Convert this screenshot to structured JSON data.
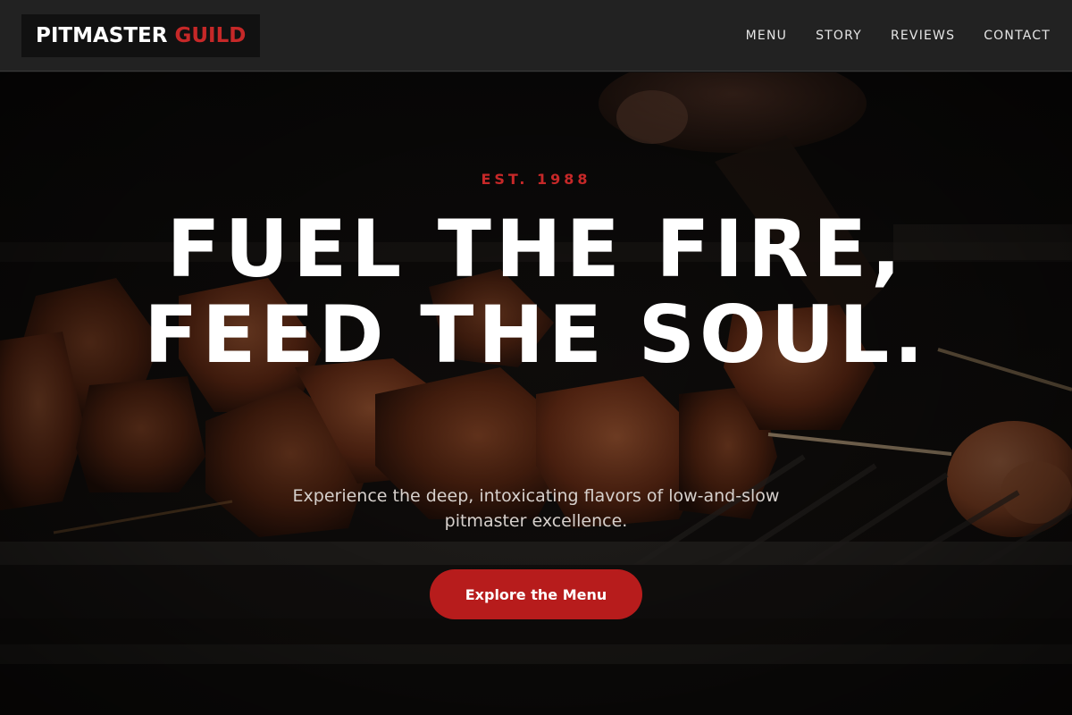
{
  "brand": {
    "name_primary": "PITMASTER",
    "name_accent": "GUILD"
  },
  "nav": {
    "items": [
      {
        "label": "MENU"
      },
      {
        "label": "STORY"
      },
      {
        "label": "REVIEWS"
      },
      {
        "label": "CONTACT"
      }
    ]
  },
  "hero": {
    "eyebrow": "EST. 1988",
    "headline": "FUEL THE FIRE, FEED THE SOUL.",
    "subtext": "Experience the deep, intoxicating flavors of low-and-slow pitmaster excellence.",
    "cta_label": "Explore the Menu"
  },
  "colors": {
    "accent": "#c62828",
    "header_bg": "#222222",
    "logo_bg": "#111111",
    "cta_bg": "#b71c1c"
  },
  "icons": {
    "background": "grilled-meat-photo"
  }
}
